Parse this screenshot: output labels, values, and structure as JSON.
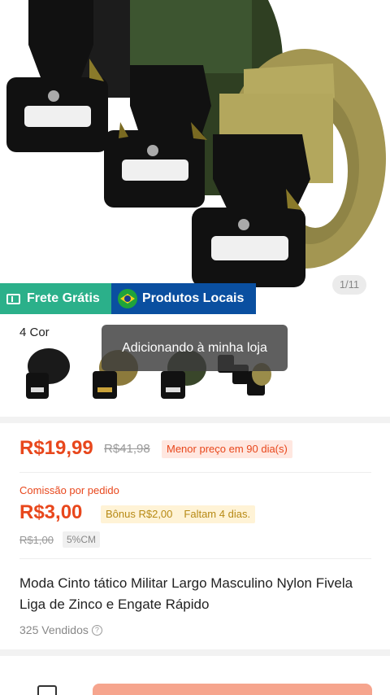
{
  "hero": {
    "image_counter": "1/11",
    "badge_shipping": "Frete Grátis",
    "badge_local": "Produtos Locais"
  },
  "variants": {
    "label": "4 Cor",
    "thumbs": [
      "black-belt",
      "tan-belt",
      "green-belt",
      "set-belt"
    ]
  },
  "toast": {
    "text": "Adicionando à minha loja"
  },
  "price": {
    "current": "R$19,99",
    "original": "R$41,98",
    "lowest_badge": "Menor preço em 90 dia(s)"
  },
  "commission": {
    "label": "Comissão por pedido",
    "value": "R$3,00",
    "bonus": "Bônus R$2,00",
    "remaining": "Faltam 4 dias.",
    "old_value": "R$1,00",
    "rate": "5%CM"
  },
  "product": {
    "title": "Moda Cinto tático Militar Largo Masculino Nylon Fivela Liga de Zinco e Engate Rápido",
    "sold": "325 Vendidos"
  },
  "colors": {
    "accent": "#e8471c",
    "shipping_badge": "#2bb08a",
    "local_badge": "#0a4fa0",
    "cta": "#f6a58e"
  }
}
